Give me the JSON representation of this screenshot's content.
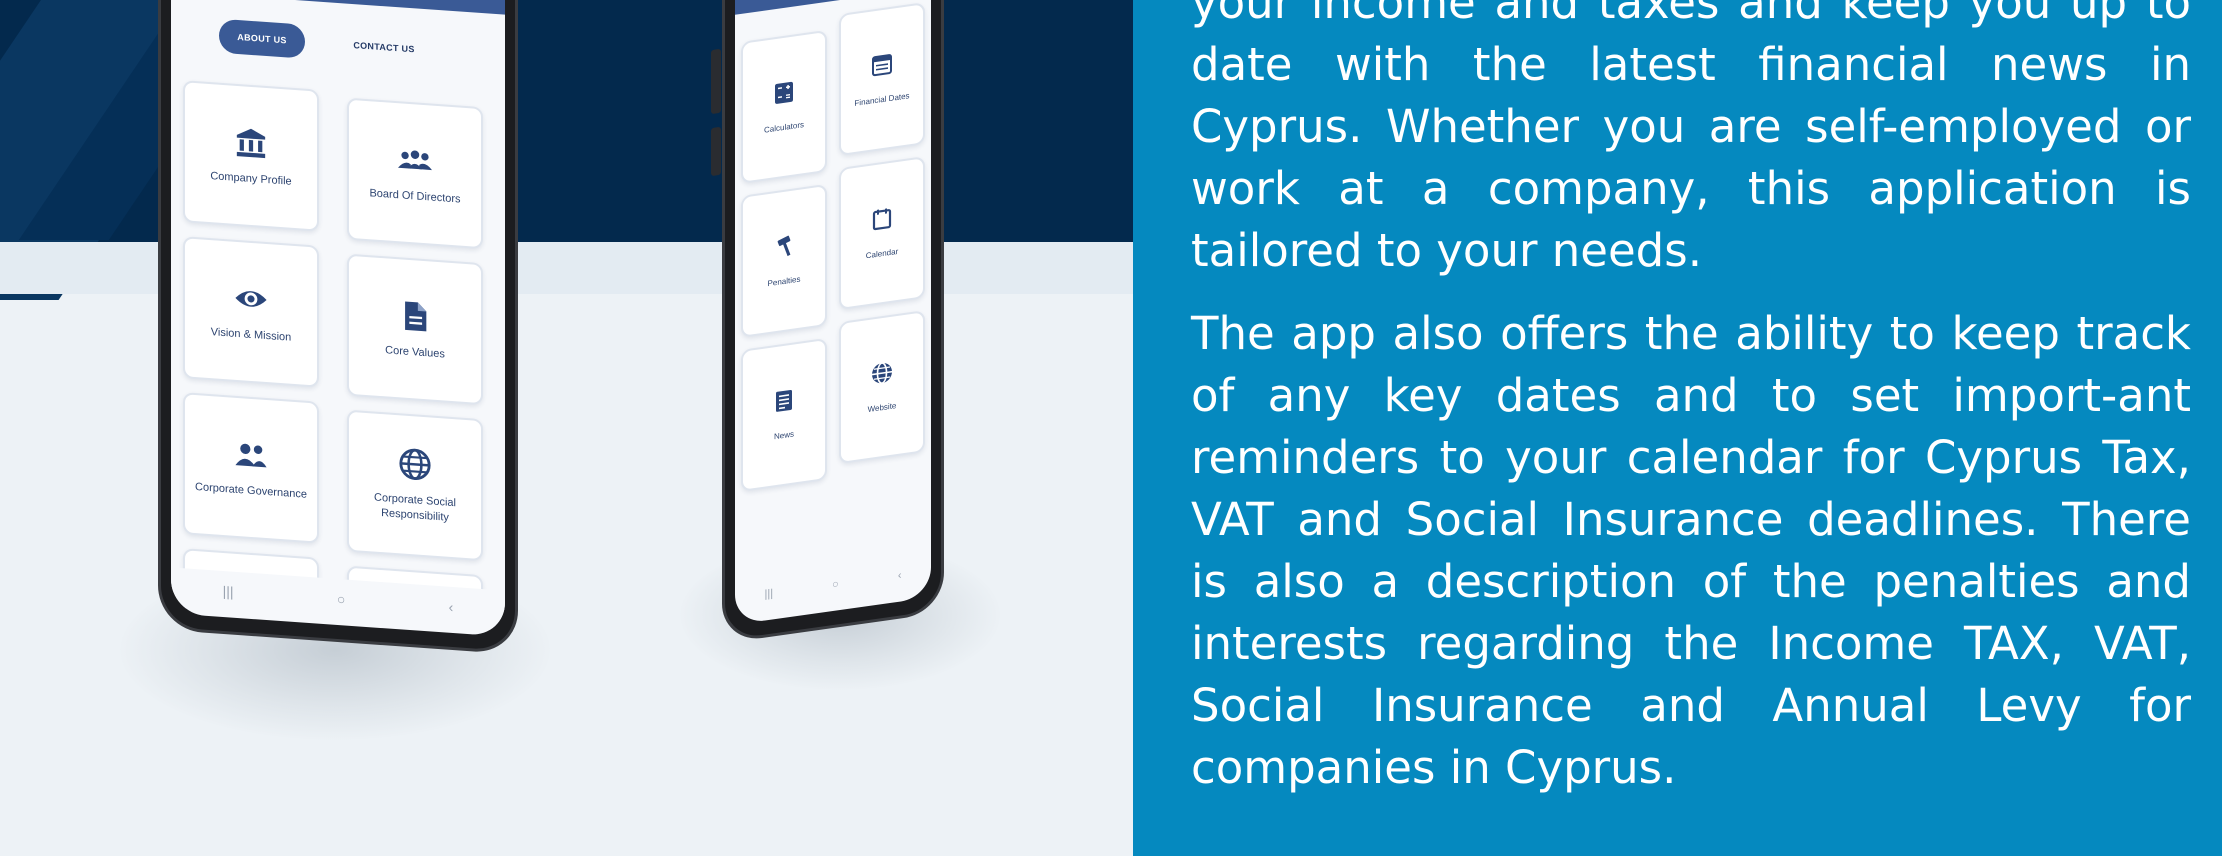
{
  "app": {
    "tabs": [
      {
        "label": "ABOUT US",
        "active": true
      },
      {
        "label": "CONTACT US",
        "active": false
      }
    ],
    "about_cards": [
      {
        "label": "Company Profile",
        "icon": "bank-icon"
      },
      {
        "label": "Board Of Directors",
        "icon": "group-icon"
      },
      {
        "label": "Vision & Mission",
        "icon": "eye-icon"
      },
      {
        "label": "Core Values",
        "icon": "document-icon"
      },
      {
        "label": "Corporate Governance",
        "icon": "people-icon"
      },
      {
        "label": "Corporate Social Responsibility",
        "icon": "globe-icon"
      }
    ],
    "tool_cards": [
      {
        "label": "Calculators",
        "icon": "calculator-icon"
      },
      {
        "label": "Financial Dates",
        "icon": "financial-dates-icon"
      },
      {
        "label": "Penalties",
        "icon": "gavel-icon"
      },
      {
        "label": "Calendar",
        "icon": "calendar-icon"
      },
      {
        "label": "News",
        "icon": "news-icon"
      },
      {
        "label": "Website",
        "icon": "globe-icon"
      }
    ],
    "nav": {
      "recents": "|||",
      "home": "○",
      "back": "‹"
    }
  },
  "description": {
    "paragraph_1": "your income and taxes and keep you up to date with the latest financial news in Cyprus. Whether you are self-employed or work at a company, this application is tailored to your needs.",
    "paragraph_2": "The app also offers the ability to keep track of any key dates and to set import-ant reminders to your calendar for Cyprus Tax, VAT and Social Insurance deadlines. There is also a description of the penalties and interests regarding the Income TAX, VAT, Social Insurance and Annual Levy for companies in Cyprus."
  },
  "colors": {
    "navy": "#03294d",
    "panel_blue": "#0589bf",
    "app_accent": "#3a5a96",
    "icon_color": "#2b467a"
  }
}
